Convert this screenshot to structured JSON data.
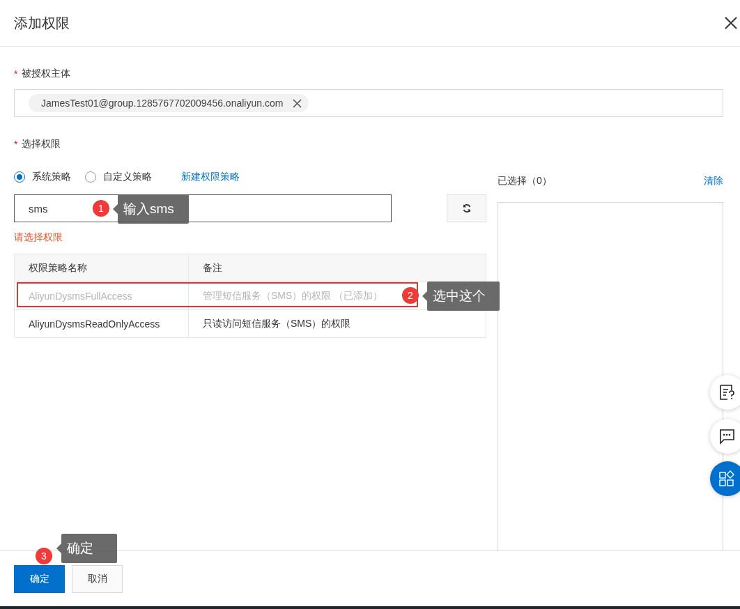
{
  "dialog": {
    "title": "添加权限"
  },
  "principal": {
    "label": "被授权主体",
    "required": "*",
    "tags": [
      {
        "text": "JamesTest01@group.1285767702009456.onaliyun.com"
      }
    ]
  },
  "permissions": {
    "label": "选择权限",
    "required": "*",
    "policy_types": [
      {
        "label": "系统策略",
        "selected": true
      },
      {
        "label": "自定义策略",
        "selected": false
      }
    ],
    "new_policy_link": "新建权限策略",
    "search": {
      "value": "sms"
    },
    "error": "请选择权限",
    "table": {
      "columns": [
        "权限策略名称",
        "备注"
      ],
      "rows": [
        {
          "name": "AliyunDysmsFullAccess",
          "note": "管理短信服务（SMS）的权限 （已添加）",
          "disabled": true,
          "highlighted": true
        },
        {
          "name": "AliyunDysmsReadOnlyAccess",
          "note": "只读访问短信服务（SMS）的权限",
          "disabled": false,
          "highlighted": false
        }
      ]
    }
  },
  "selected_panel": {
    "title": "已选择（0）",
    "clear": "清除"
  },
  "buttons": [
    {
      "label": "确定",
      "kind": "primary"
    },
    {
      "label": "取消",
      "kind": "secondary"
    }
  ],
  "annotations": [
    {
      "number": "1",
      "text": "输入sms"
    },
    {
      "number": "2",
      "text": "选中这个"
    },
    {
      "number": "3",
      "text": "确定"
    }
  ]
}
